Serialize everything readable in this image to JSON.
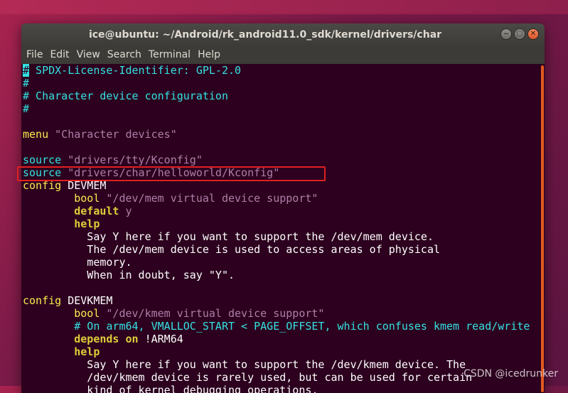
{
  "window": {
    "title": "ice@ubuntu: ~/Android/rk_android11.0_sdk/kernel/drivers/char",
    "buttons": {
      "minimize": "‒",
      "maximize": "▢",
      "close": "✕"
    }
  },
  "menu": [
    "File",
    "Edit",
    "View",
    "Search",
    "Terminal",
    "Help"
  ],
  "colors": {
    "terminal_bg": "#2c001e",
    "comment": "#34e2e2",
    "keyword": "#e0cd3a",
    "string": "#ad7fa8",
    "highlight_box": "#e02020",
    "scrollbar_thumb": "#e25a1f"
  },
  "terminal": {
    "cursor_char": "#",
    "lines": [
      {
        "t1": " SPDX-License-Identifier: GPL-2.0"
      },
      {
        "t1": "#"
      },
      {
        "t1": "# Character device configuration"
      },
      {
        "t1": "#"
      },
      {
        "t1": ""
      },
      {
        "t1": "menu",
        "t2": " \"Character devices\""
      },
      {
        "t1": ""
      },
      {
        "t1": "source",
        "t2": " \"drivers/tty/Kconfig\""
      },
      {
        "t1": "source",
        "t2": " \"drivers/char/helloworld/Kconfig\""
      },
      {
        "t1": "config",
        "t2": " DEVMEM"
      },
      {
        "t0": "        ",
        "t1": "bool",
        "t2": " \"/dev/mem virtual device support\""
      },
      {
        "t0": "        ",
        "t1": "default",
        "t2": " y"
      },
      {
        "t0": "        ",
        "t1": "help"
      },
      {
        "t1": "          Say Y here if you want to support the /dev/mem device."
      },
      {
        "t1": "          The /dev/mem device is used to access areas of physical"
      },
      {
        "t1": "          memory."
      },
      {
        "t1": "          When in doubt, say \"Y\"."
      },
      {
        "t1": ""
      },
      {
        "t1": "config",
        "t2": " DEVKMEM"
      },
      {
        "t0": "        ",
        "t1": "bool",
        "t2": " \"/dev/kmem virtual device support\""
      },
      {
        "t1": "        # On arm64, VMALLOC_START < PAGE_OFFSET, which confuses kmem read/write"
      },
      {
        "t0": "        ",
        "t1": "depends on",
        "t2": " !ARM64"
      },
      {
        "t0": "        ",
        "t1": "help"
      },
      {
        "t1": "          Say Y here if you want to support the /dev/kmem device. The"
      },
      {
        "t1": "          /dev/kmem device is rarely used, but can be used for certain"
      },
      {
        "t1": "          kind of kernel debugging operations."
      }
    ]
  },
  "watermark": "CSDN @icedrunker"
}
